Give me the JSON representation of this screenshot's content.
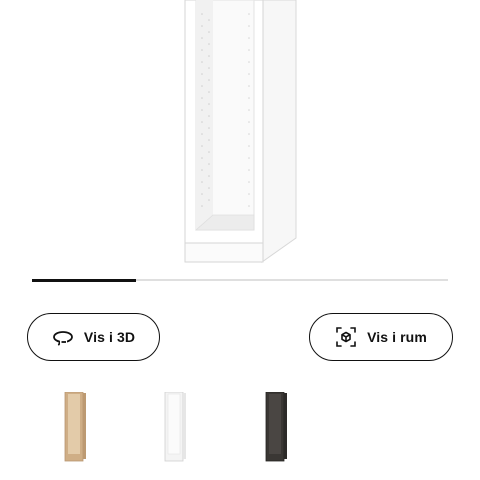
{
  "product": {
    "image_icon": "white-wardrobe-frame-image"
  },
  "carousel": {
    "progress": 0.25
  },
  "actions": {
    "view_3d": {
      "label": "Vis i 3D",
      "icon": "rotate-3d-icon"
    },
    "view_room": {
      "label": "Vis i rum",
      "icon": "view-in-room-icon"
    }
  },
  "variants": [
    {
      "name": "white-stained-oak-effect",
      "color": "#cfae86"
    },
    {
      "name": "white",
      "color": "#f4f4f4"
    },
    {
      "name": "black-brown",
      "color": "#3a3734"
    }
  ],
  "colors": {
    "text": "#111111",
    "track": "#dfdfdf"
  }
}
